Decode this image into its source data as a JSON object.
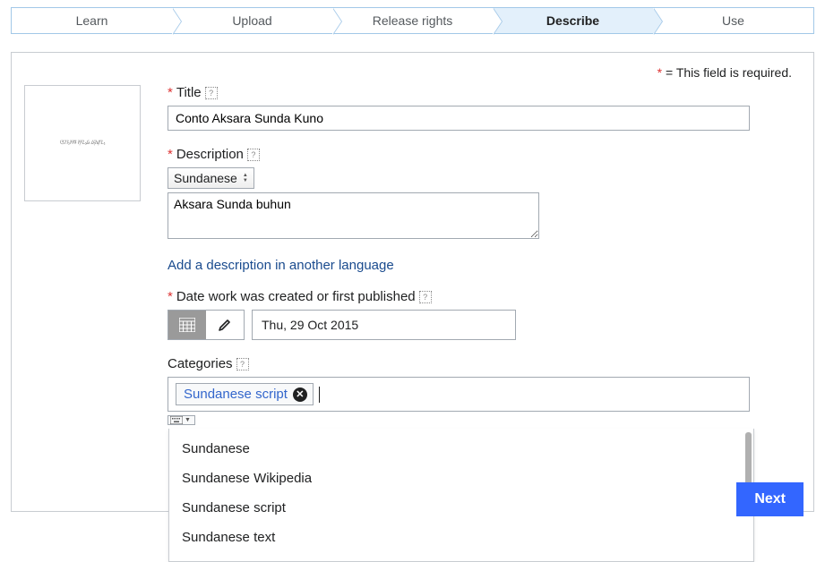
{
  "wizard": {
    "steps": [
      {
        "label": "Learn"
      },
      {
        "label": "Upload"
      },
      {
        "label": "Release rights"
      },
      {
        "label": "Describe",
        "active": true
      },
      {
        "label": "Use"
      }
    ]
  },
  "required_note": {
    "star": "*",
    "text": " = This field is required."
  },
  "thumbnail_placeholder": "ᮃᮊ᮪ᮞᮛ ᮞᮥᮔ᮪ᮓ ᮘᮥᮠᮥᮔ᮪",
  "fields": {
    "title": {
      "star": "*",
      "label": "Title",
      "value": "Conto Aksara Sunda Kuno"
    },
    "description": {
      "star": "*",
      "label": "Description",
      "language": "Sundanese",
      "value": "Aksara Sunda buhun"
    },
    "add_language_link": "Add a description in another language",
    "date": {
      "star": "*",
      "label": "Date work was created or first published",
      "value": "Thu, 29 Oct 2015"
    },
    "categories": {
      "label": "Categories",
      "tag": "Sundanese script",
      "suggestions": [
        "Sundanese",
        "Sundanese Wikipedia",
        "Sundanese script",
        "Sundanese text"
      ]
    }
  },
  "next_button": "Next"
}
